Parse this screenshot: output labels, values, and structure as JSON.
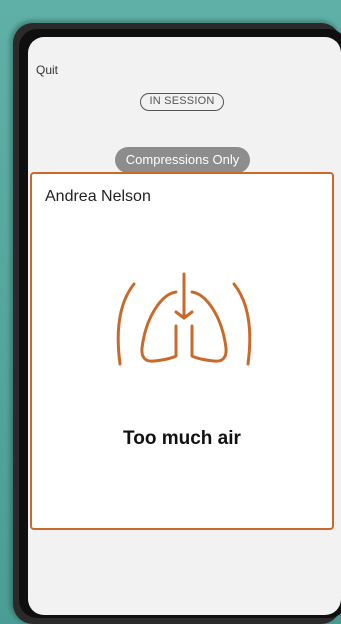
{
  "header": {
    "quit_label": "Quit",
    "session_status": "IN SESSION",
    "mode_label": "Compressions Only"
  },
  "card": {
    "patient_name": "Andrea Nelson",
    "status_icon": "lungs-icon",
    "status_text": "Too much air"
  },
  "colors": {
    "accent": "#c96a2a",
    "mode_pill": "#8d8d8d",
    "background": "#4a9d94"
  }
}
